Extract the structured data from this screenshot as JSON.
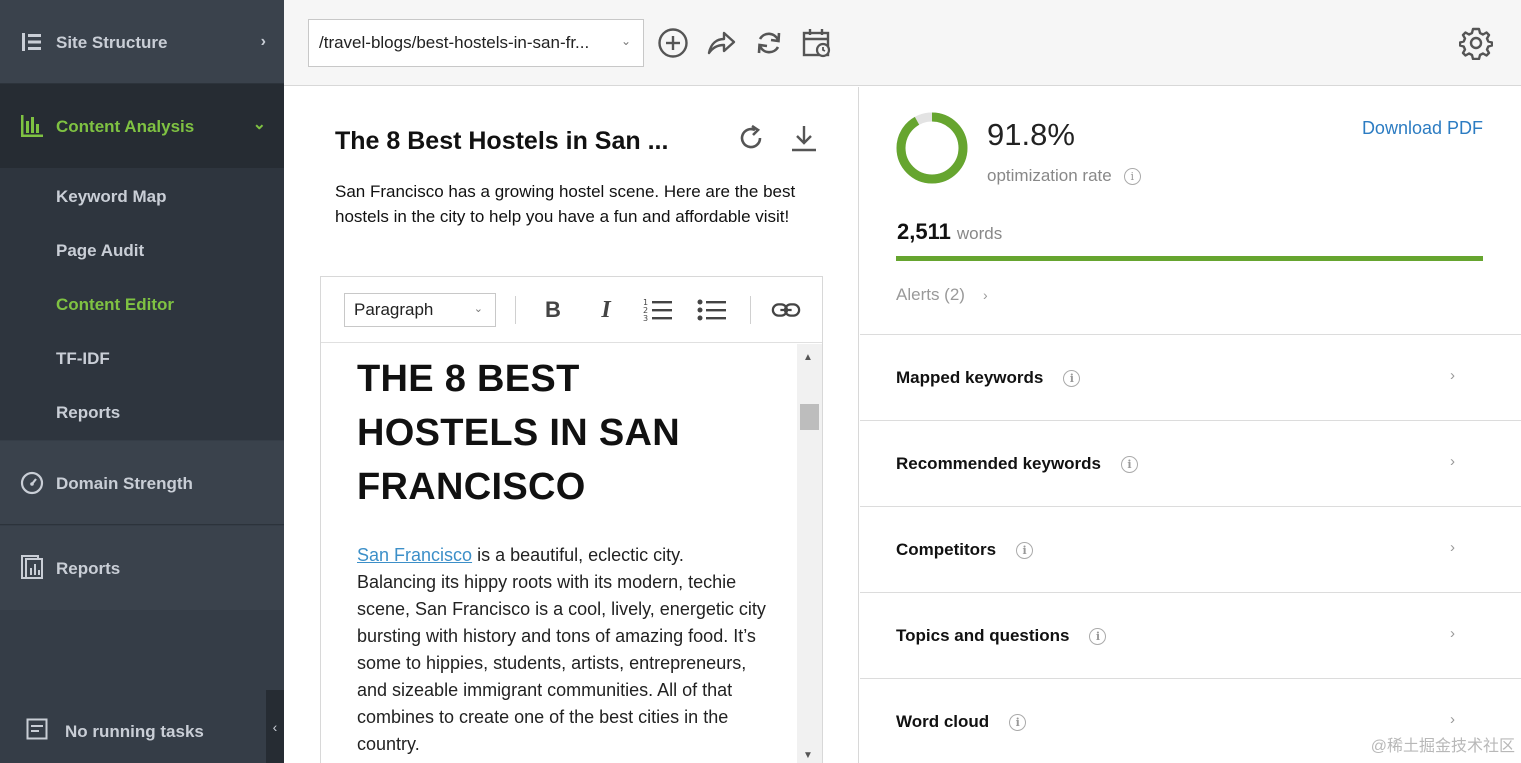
{
  "sidebar": {
    "site_structure": "Site Structure",
    "content_analysis": "Content Analysis",
    "sub_items": [
      "Keyword Map",
      "Page Audit",
      "Content Editor",
      "TF-IDF",
      "Reports"
    ],
    "active_sub_item": "Content Editor",
    "domain_strength": "Domain Strength",
    "reports": "Reports",
    "tasks": "No running tasks"
  },
  "topbar": {
    "url": "/travel-blogs/best-hostels-in-san-fr...",
    "icons": [
      "add-icon",
      "share-icon",
      "sync-icon",
      "calendar-icon",
      "gear-icon"
    ]
  },
  "document": {
    "title": "The 8 Best Hostels in San ...",
    "description": "San Francisco has a growing hostel scene. Here are the best hostels in the city to help you have a fun and affordable visit!",
    "format": "Paragraph",
    "heading": "THE 8 BEST HOSTELS IN SAN FRANCISCO",
    "link_text": "San Francisco",
    "body": " is a beautiful, eclectic city. Balancing its hippy roots with its modern, techie scene, San Francisco is a cool, lively, energetic city bursting with history and tons of amazing food. It’s some to hippies, students, artists, entrepreneurs, and sizeable immigrant communities. All of that combines to create one of the best cities in the country."
  },
  "stats": {
    "rate": "91.8%",
    "rate_value": 91.8,
    "rate_label": "optimization rate",
    "download": "Download PDF",
    "words_count": "2,511",
    "words_label": "words",
    "alerts": "Alerts (2)",
    "accent": "#66a52f"
  },
  "sections": [
    "Mapped keywords",
    "Recommended keywords",
    "Competitors",
    "Topics and questions",
    "Word cloud"
  ],
  "watermark": "@稀土掘金技术社区"
}
